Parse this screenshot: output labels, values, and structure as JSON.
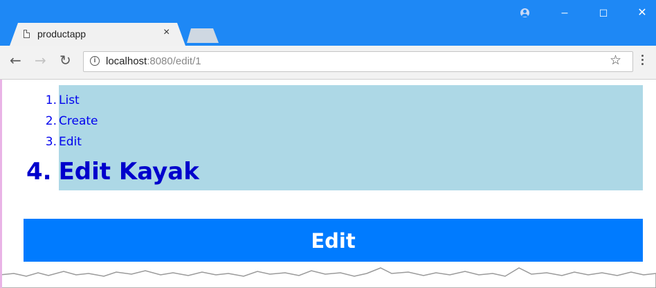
{
  "browser": {
    "tab": {
      "title": "productapp",
      "close_glyph": "×"
    },
    "window_controls": {
      "minimize": "–",
      "maximize": "☐",
      "close": "✕"
    },
    "address": {
      "host": "localhost",
      "rest": ":8080/edit/1"
    },
    "icons": [
      "page-icon",
      "profile-icon",
      "back-icon",
      "forward-icon",
      "reload-icon",
      "info-icon",
      "star-icon",
      "menu-icon"
    ],
    "colors": {
      "titlebar": "#1e88f5",
      "toolbar": "#f2f2f2"
    }
  },
  "page": {
    "nav": {
      "items": [
        {
          "number": "1.",
          "label": "List"
        },
        {
          "number": "2.",
          "label": "Create"
        },
        {
          "number": "3.",
          "label": "Edit"
        }
      ],
      "active": {
        "number": "4.",
        "label": "Edit Kayak"
      },
      "band_color": "#add8e6",
      "link_color": "#0000ee"
    },
    "edit_button": {
      "label": "Edit",
      "color": "#007bff"
    }
  }
}
